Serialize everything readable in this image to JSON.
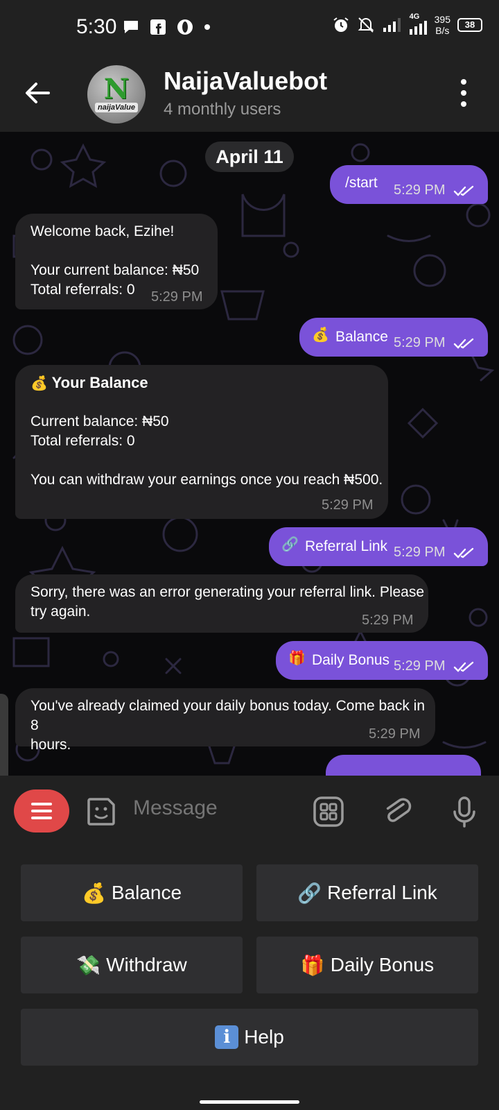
{
  "status_bar": {
    "time": "5:30",
    "speed_value": "395",
    "speed_unit": "B/s",
    "network": "4G",
    "battery": "38"
  },
  "header": {
    "title": "NaijaValuebot",
    "subtitle": "4 monthly users",
    "avatar_text": "naijaValue"
  },
  "chat": {
    "date": "April 11",
    "messages": [
      {
        "dir": "out",
        "text": "/start",
        "time": "5:29 PM"
      },
      {
        "dir": "in",
        "lines": [
          "Welcome back, Ezihe!",
          "",
          "Your current balance: ₦50",
          "Total referrals: 0"
        ],
        "time": "5:29 PM"
      },
      {
        "dir": "out",
        "text": "Balance",
        "emoji": "money-bag",
        "time": "5:29 PM"
      },
      {
        "dir": "in",
        "heading": "Your Balance",
        "emoji": "money-bag",
        "lines": [
          "Current balance: ₦50",
          "Total referrals: 0",
          "",
          "You can withdraw your earnings once you reach ₦500."
        ],
        "time": "5:29 PM"
      },
      {
        "dir": "out",
        "text": "Referral Link",
        "emoji": "link",
        "time": "5:29 PM"
      },
      {
        "dir": "in",
        "lines": [
          "Sorry, there was an error generating your referral link. Please",
          "try again."
        ],
        "time": "5:29 PM"
      },
      {
        "dir": "out",
        "text": "Daily Bonus",
        "emoji": "gift",
        "time": "5:29 PM"
      },
      {
        "dir": "in",
        "lines": [
          "You've already claimed your daily bonus today. Come back in 8",
          "hours."
        ],
        "time": "5:29 PM"
      }
    ]
  },
  "input": {
    "placeholder": "Message"
  },
  "keyboard": {
    "buttons": [
      {
        "label": "Balance",
        "emoji": "💰"
      },
      {
        "label": "Referral Link",
        "emoji": "🔗"
      },
      {
        "label": "Withdraw",
        "emoji": "💸"
      },
      {
        "label": "Daily Bonus",
        "emoji": "🎁"
      },
      {
        "label": "Help",
        "emoji": "ℹ"
      }
    ]
  },
  "colors": {
    "outgoing_bubble": "#7a52d9",
    "incoming_bubble": "#232224",
    "menu_button": "#e04848",
    "bar_background": "#212121"
  }
}
